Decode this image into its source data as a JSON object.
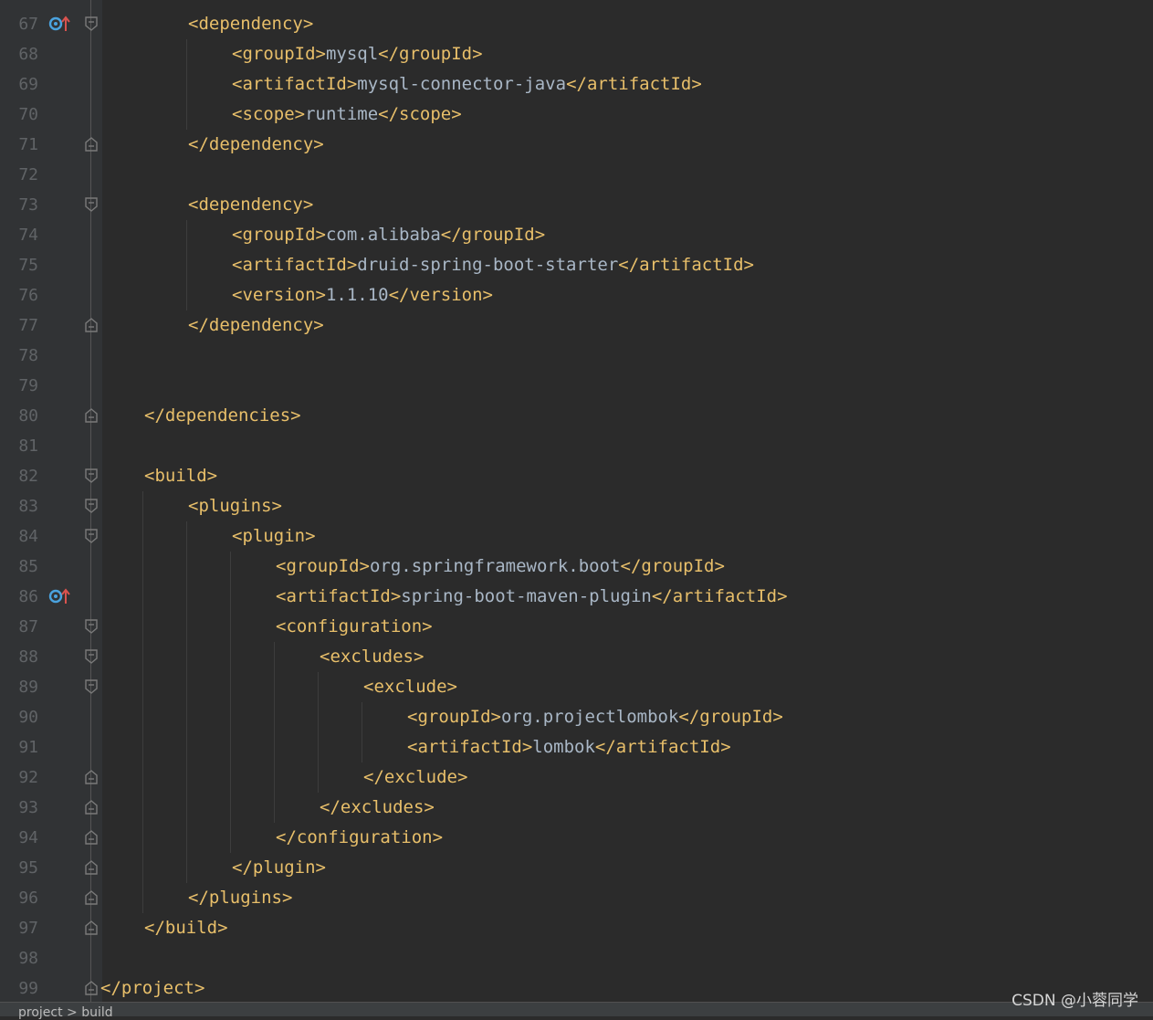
{
  "editor": {
    "lines": [
      {
        "num": "67",
        "tokens": [
          {
            "t": "tag",
            "v": "<dependency>"
          }
        ],
        "indent": 2,
        "fold": "open",
        "icon": "override-icon"
      },
      {
        "num": "68",
        "tokens": [
          {
            "t": "tag",
            "v": "<groupId>"
          },
          {
            "t": "txt",
            "v": "mysql"
          },
          {
            "t": "tag",
            "v": "</groupId>"
          }
        ],
        "indent": 3
      },
      {
        "num": "69",
        "tokens": [
          {
            "t": "tag",
            "v": "<artifactId>"
          },
          {
            "t": "txt",
            "v": "mysql-connector-java"
          },
          {
            "t": "tag",
            "v": "</artifactId>"
          }
        ],
        "indent": 3
      },
      {
        "num": "70",
        "tokens": [
          {
            "t": "tag",
            "v": "<scope>"
          },
          {
            "t": "txt",
            "v": "runtime"
          },
          {
            "t": "tag",
            "v": "</scope>"
          }
        ],
        "indent": 3
      },
      {
        "num": "71",
        "tokens": [
          {
            "t": "tag",
            "v": "</dependency>"
          }
        ],
        "indent": 2,
        "fold": "close"
      },
      {
        "num": "72",
        "tokens": [],
        "indent": 0
      },
      {
        "num": "73",
        "tokens": [
          {
            "t": "tag",
            "v": "<dependency>"
          }
        ],
        "indent": 2,
        "fold": "open"
      },
      {
        "num": "74",
        "tokens": [
          {
            "t": "tag",
            "v": "<groupId>"
          },
          {
            "t": "txt",
            "v": "com.alibaba"
          },
          {
            "t": "tag",
            "v": "</groupId>"
          }
        ],
        "indent": 3
      },
      {
        "num": "75",
        "tokens": [
          {
            "t": "tag",
            "v": "<artifactId>"
          },
          {
            "t": "txt",
            "v": "druid-spring-boot-starter"
          },
          {
            "t": "tag",
            "v": "</artifactId>"
          }
        ],
        "indent": 3
      },
      {
        "num": "76",
        "tokens": [
          {
            "t": "tag",
            "v": "<version>"
          },
          {
            "t": "txt",
            "v": "1.1.10"
          },
          {
            "t": "tag",
            "v": "</version>"
          }
        ],
        "indent": 3
      },
      {
        "num": "77",
        "tokens": [
          {
            "t": "tag",
            "v": "</dependency>"
          }
        ],
        "indent": 2,
        "fold": "close"
      },
      {
        "num": "78",
        "tokens": [],
        "indent": 0
      },
      {
        "num": "79",
        "tokens": [],
        "indent": 0
      },
      {
        "num": "80",
        "tokens": [
          {
            "t": "tag",
            "v": "</dependencies>"
          }
        ],
        "indent": 1,
        "fold": "close"
      },
      {
        "num": "81",
        "tokens": [],
        "indent": 0
      },
      {
        "num": "82",
        "tokens": [
          {
            "t": "tag",
            "v": "<build>"
          }
        ],
        "indent": 1,
        "fold": "open"
      },
      {
        "num": "83",
        "tokens": [
          {
            "t": "tag",
            "v": "<plugins>"
          }
        ],
        "indent": 2,
        "fold": "open"
      },
      {
        "num": "84",
        "tokens": [
          {
            "t": "tag",
            "v": "<plugin>"
          }
        ],
        "indent": 3,
        "fold": "open"
      },
      {
        "num": "85",
        "tokens": [
          {
            "t": "tag",
            "v": "<groupId>"
          },
          {
            "t": "txt",
            "v": "org.springframework.boot"
          },
          {
            "t": "tag",
            "v": "</groupId>"
          }
        ],
        "indent": 4
      },
      {
        "num": "86",
        "tokens": [
          {
            "t": "tag",
            "v": "<artifactId>"
          },
          {
            "t": "txt",
            "v": "spring-boot-maven-plugin"
          },
          {
            "t": "tag",
            "v": "</artifactId>"
          }
        ],
        "indent": 4,
        "icon": "override-icon"
      },
      {
        "num": "87",
        "tokens": [
          {
            "t": "tag",
            "v": "<configuration>"
          }
        ],
        "indent": 4,
        "fold": "open"
      },
      {
        "num": "88",
        "tokens": [
          {
            "t": "tag",
            "v": "<excludes>"
          }
        ],
        "indent": 5,
        "fold": "open"
      },
      {
        "num": "89",
        "tokens": [
          {
            "t": "tag",
            "v": "<exclude>"
          }
        ],
        "indent": 6,
        "fold": "open"
      },
      {
        "num": "90",
        "tokens": [
          {
            "t": "tag",
            "v": "<groupId>"
          },
          {
            "t": "txt",
            "v": "org.projectlombok"
          },
          {
            "t": "tag",
            "v": "</groupId>"
          }
        ],
        "indent": 7
      },
      {
        "num": "91",
        "tokens": [
          {
            "t": "tag",
            "v": "<artifactId>"
          },
          {
            "t": "txt",
            "v": "lombok"
          },
          {
            "t": "tag",
            "v": "</artifactId>"
          }
        ],
        "indent": 7
      },
      {
        "num": "92",
        "tokens": [
          {
            "t": "tag",
            "v": "</exclude>"
          }
        ],
        "indent": 6,
        "fold": "close"
      },
      {
        "num": "93",
        "tokens": [
          {
            "t": "tag",
            "v": "</excludes>"
          }
        ],
        "indent": 5,
        "fold": "close"
      },
      {
        "num": "94",
        "tokens": [
          {
            "t": "tag",
            "v": "</configuration>"
          }
        ],
        "indent": 4,
        "fold": "close"
      },
      {
        "num": "95",
        "tokens": [
          {
            "t": "tag",
            "v": "</plugin>"
          }
        ],
        "indent": 3,
        "fold": "close"
      },
      {
        "num": "96",
        "tokens": [
          {
            "t": "tag",
            "v": "</plugins>"
          }
        ],
        "indent": 2,
        "fold": "close"
      },
      {
        "num": "97",
        "tokens": [
          {
            "t": "tag",
            "v": "</build>"
          }
        ],
        "indent": 1,
        "fold": "close"
      },
      {
        "num": "98",
        "tokens": [],
        "indent": 0
      },
      {
        "num": "99",
        "tokens": [
          {
            "t": "tag",
            "v": "</project>"
          }
        ],
        "indent": 0,
        "fold": "close"
      }
    ]
  },
  "colors": {
    "background": "#2b2b2b",
    "gutter": "#313335",
    "line_number": "#606366",
    "tag": "#e8bf6a",
    "text": "#a9b7c6",
    "override_icon_blue": "#4aa3df",
    "override_icon_red": "#d9534f"
  },
  "status_bar": {
    "text": "project > build"
  },
  "watermark": {
    "text": "CSDN @小蓉同学"
  }
}
